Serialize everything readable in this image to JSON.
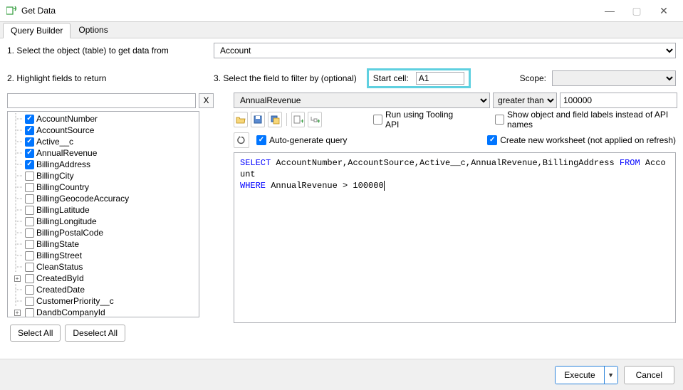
{
  "window": {
    "title": "Get Data"
  },
  "tabs": [
    "Query Builder",
    "Options"
  ],
  "step1_label": "1. Select the object (table) to get data from",
  "object_selected": "Account",
  "step2_label": "2. Highlight fields to return",
  "step3_label": "3. Select the field to filter by (optional)",
  "start_cell_label": "Start cell:",
  "start_cell_value": "A1",
  "scope_label": "Scope:",
  "scope_value": "",
  "filter_field": "AnnualRevenue",
  "filter_operator": "greater than",
  "filter_value": "100000",
  "tree_fields": [
    {
      "label": "AccountNumber",
      "checked": true,
      "expand": null
    },
    {
      "label": "AccountSource",
      "checked": true,
      "expand": null
    },
    {
      "label": "Active__c",
      "checked": true,
      "expand": null
    },
    {
      "label": "AnnualRevenue",
      "checked": true,
      "expand": null
    },
    {
      "label": "BillingAddress",
      "checked": true,
      "expand": null
    },
    {
      "label": "BillingCity",
      "checked": false,
      "expand": null
    },
    {
      "label": "BillingCountry",
      "checked": false,
      "expand": null
    },
    {
      "label": "BillingGeocodeAccuracy",
      "checked": false,
      "expand": null
    },
    {
      "label": "BillingLatitude",
      "checked": false,
      "expand": null
    },
    {
      "label": "BillingLongitude",
      "checked": false,
      "expand": null
    },
    {
      "label": "BillingPostalCode",
      "checked": false,
      "expand": null
    },
    {
      "label": "BillingState",
      "checked": false,
      "expand": null
    },
    {
      "label": "BillingStreet",
      "checked": false,
      "expand": null
    },
    {
      "label": "CleanStatus",
      "checked": false,
      "expand": null
    },
    {
      "label": "CreatedById",
      "checked": false,
      "expand": "+"
    },
    {
      "label": "CreatedDate",
      "checked": false,
      "expand": null
    },
    {
      "label": "CustomerPriority__c",
      "checked": false,
      "expand": null
    },
    {
      "label": "DandbCompanyId",
      "checked": false,
      "expand": "+"
    }
  ],
  "select_all": "Select All",
  "deselect_all": "Deselect All",
  "tool_labels": {
    "run_tooling": "Run using Tooling API",
    "show_labels": "Show object and field labels instead of API names",
    "auto_generate": "Auto-generate query",
    "create_worksheet": "Create new worksheet (not applied on refresh)"
  },
  "query": {
    "select_kw": "SELECT",
    "fields": " AccountNumber,AccountSource,Active__c,AnnualRevenue,BillingAddress ",
    "from_kw": "FROM",
    "object": " Account ",
    "where_kw": "WHERE",
    "condition": " AnnualRevenue > 100000"
  },
  "footer": {
    "execute": "Execute",
    "cancel": "Cancel"
  }
}
